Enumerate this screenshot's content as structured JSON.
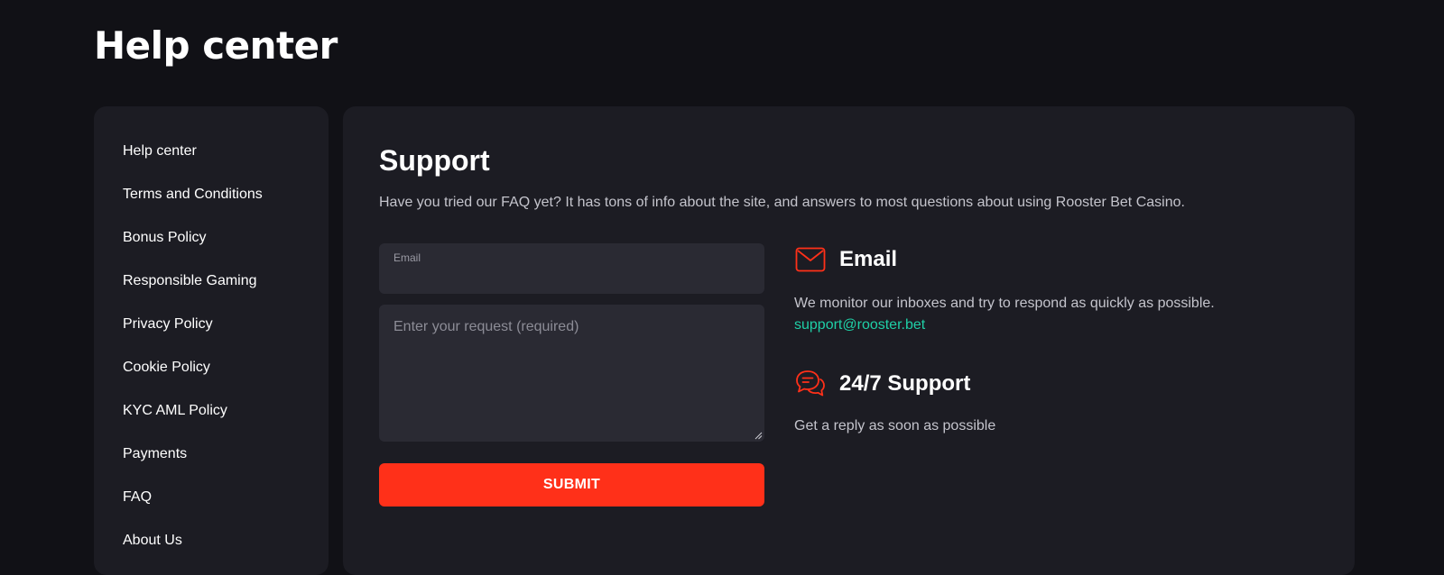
{
  "page": {
    "title": "Help center"
  },
  "sidebar": {
    "items": [
      {
        "label": "Help center"
      },
      {
        "label": "Terms and Conditions"
      },
      {
        "label": "Bonus Policy"
      },
      {
        "label": "Responsible Gaming"
      },
      {
        "label": "Privacy Policy"
      },
      {
        "label": "Cookie Policy"
      },
      {
        "label": "KYC AML Policy"
      },
      {
        "label": "Payments"
      },
      {
        "label": "FAQ"
      },
      {
        "label": "About Us"
      }
    ]
  },
  "support": {
    "title": "Support",
    "description": "Have you tried our FAQ yet? It has tons of info about the site, and answers to most questions about using Rooster Bet Casino."
  },
  "form": {
    "email_label": "Email",
    "email_value": "",
    "request_placeholder": "Enter your request (required)",
    "request_value": "",
    "submit_label": "SUBMIT"
  },
  "contact": {
    "email": {
      "icon": "envelope-icon",
      "title": "Email",
      "text": "We monitor our inboxes and try to respond as quickly as possible.",
      "link": "support@rooster.bet"
    },
    "support": {
      "icon": "chat-bubbles-icon",
      "title": "24/7 Support",
      "text": "Get a reply as soon as possible"
    }
  },
  "colors": {
    "background": "#111116",
    "card": "#1c1c23",
    "field": "#2a2a33",
    "accent": "#ff3019",
    "link": "#1fcfa6"
  }
}
